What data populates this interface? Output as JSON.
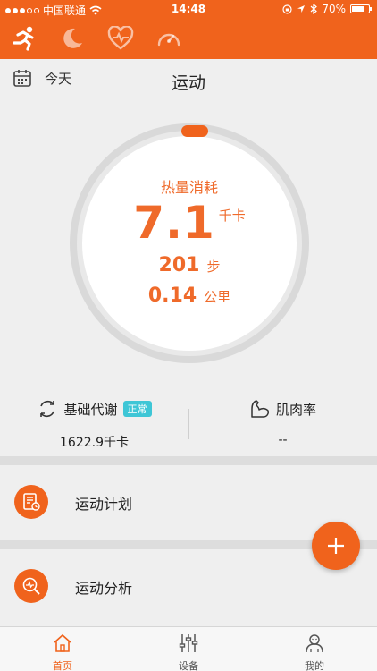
{
  "status_bar": {
    "carrier": "中国联通",
    "time": "14:48",
    "battery": "70%"
  },
  "header": {
    "date_label": "今天",
    "title": "运动"
  },
  "summary": {
    "kcal_label": "热量消耗",
    "kcal_value": "7.1",
    "kcal_unit": "千卡",
    "steps_value": "201",
    "steps_unit": "步",
    "distance_value": "0.14",
    "distance_unit": "公里"
  },
  "metrics": {
    "bmr_label": "基础代谢",
    "bmr_badge": "正常",
    "bmr_value": "1622.9千卡",
    "muscle_label": "肌肉率",
    "muscle_value": "--"
  },
  "list": {
    "plan_label": "运动计划",
    "analysis_label": "运动分析"
  },
  "tabbar": {
    "home": "首页",
    "devices": "设备",
    "mine": "我的"
  },
  "colors": {
    "accent": "#f0631c",
    "badge": "#3ec6d6"
  }
}
